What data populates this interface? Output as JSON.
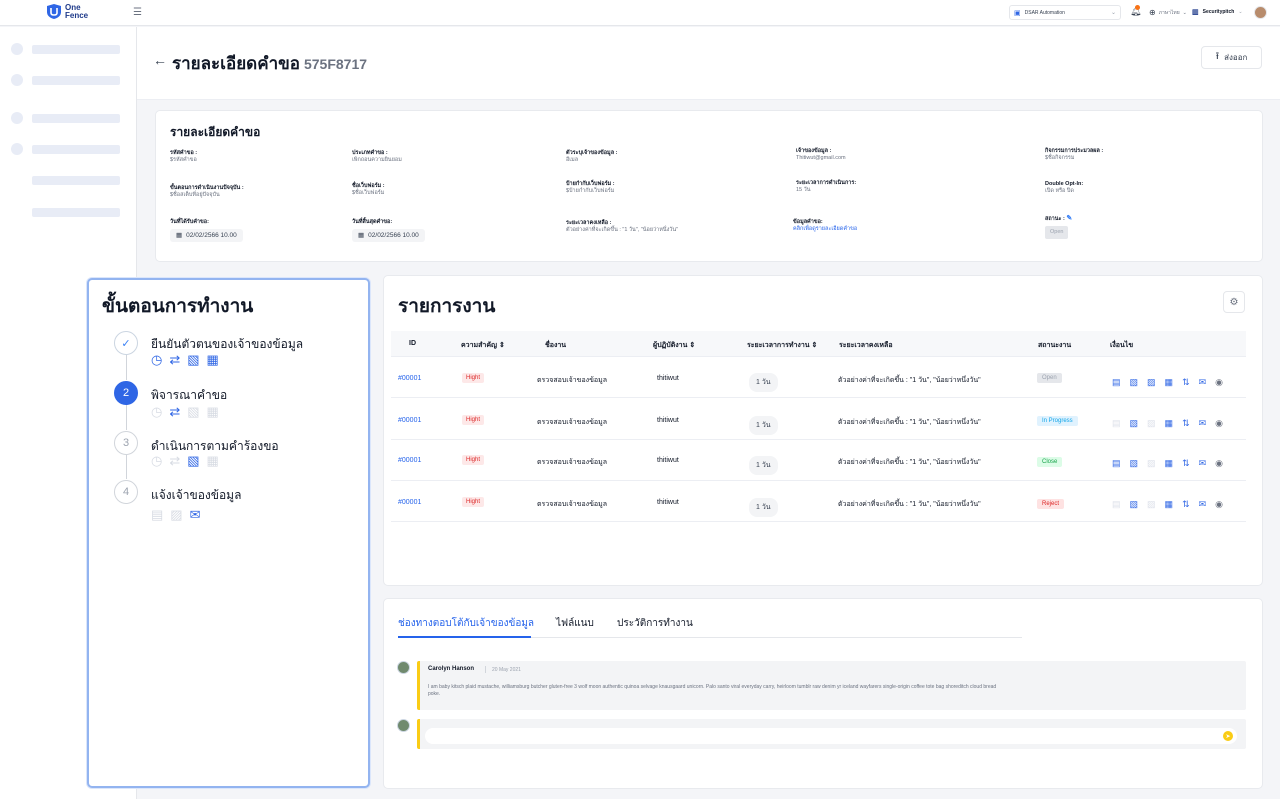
{
  "app": {
    "logo_line1": "One",
    "logo_line2": "Fence",
    "menu_icon": "menu-icon"
  },
  "topbar": {
    "workspace": "DSAR Automation",
    "language": "ภาษาไทย",
    "organization": "Securitypitch",
    "notification_icon": "bell-icon",
    "globe_icon": "globe-icon"
  },
  "page": {
    "title": "รายละเอียดคำขอ",
    "request_id": "575F8717",
    "export_label": "ส่งออก"
  },
  "request_details": {
    "title": "รายละเอียดคำขอ",
    "fields": [
      {
        "label": "รหัสคำขอ :",
        "value": "$รหัสคำขอ"
      },
      {
        "label": "ประเภทคำขอ :",
        "value": "เพิกถอนความยินยอม"
      },
      {
        "label": "ตัวระบุเจ้าของข้อมูล :",
        "value": "อีเมล"
      },
      {
        "label": "เจ้าของข้อมูล :",
        "value": "Thitiwut@gmail.com"
      },
      {
        "label": "กิจกรรมการประมวลผล :",
        "value": "$ชื่อกิจกรรม"
      },
      {
        "label": "ขั้นตอนการดำเนินงานปัจจุบัน :",
        "value": "$ชื่อสเต็บที่อยู่ปัจจุบัน"
      },
      {
        "label": "ชื่อเว็บฟอร์ม :",
        "value": "$ชื่อเว็บฟอร์ม"
      },
      {
        "label": "ป้ายกำกับเว็บฟอร์ม :",
        "value": "$ป้ายกำกับเว็บฟอร์ม"
      },
      {
        "label": "ระยะเวลาการดำเนินการ:",
        "value": "15 วัน"
      },
      {
        "label": "Double Opt-In:",
        "value": "เปิด หรือ ปิด"
      },
      {
        "label": "วันที่ได้รับคำขอ:",
        "value": "02/02/2566 10.00"
      },
      {
        "label": "วันที่สิ้นสุดคำขอ:",
        "value": "02/02/2566 10.00"
      },
      {
        "label": "ระยะเวลาคงเหลือ :",
        "value": "ตัวอย่างค่าที่จะเกิดขึ้น : \"1  วัน\", \"น้อยว่าหนึ่งวัน\""
      },
      {
        "label": "ข้อมูลคำขอ:",
        "value": "คลิกเพื่อดูรายละเอียดคำขอ"
      },
      {
        "label": "สถานะ :",
        "value": "Open"
      }
    ]
  },
  "workflow": {
    "title": "ขั้นตอนการทำงาน",
    "steps": [
      {
        "number": "✓",
        "label": "ยืนยันตัวตนของเจ้าของข้อมูล"
      },
      {
        "number": "2",
        "label": "พิจารณาคำขอ"
      },
      {
        "number": "3",
        "label": "ดำเนินการตามคำร้องขอ"
      },
      {
        "number": "4",
        "label": "แจ้งเจ้าของข้อมูล"
      }
    ]
  },
  "tasks": {
    "title": "รายการงาน",
    "columns": [
      "ID",
      "ความสำคัญ ⇕",
      "ชื่องาน",
      "ผู้ปฏิบัติงาน ⇕",
      "ระยะเวลาการทำงาน ⇕",
      "ระยะเวลาคงเหลือ",
      "สถานะงาน",
      "เงื่อนไข"
    ],
    "rows": [
      {
        "id": "#00001",
        "priority": "Hight",
        "name": "ตรวจสอบเจ้าของข้อมูล",
        "assignee": "thitiwut",
        "duration": "1 วัน",
        "remaining": "ตัวอย่างค่าที่จะเกิดขึ้น : \"1  วัน\", \"น้อยว่าหนึ่งวัน\"",
        "status": "Open"
      },
      {
        "id": "#00001",
        "priority": "Hight",
        "name": "ตรวจสอบเจ้าของข้อมูล",
        "assignee": "thitiwut",
        "duration": "1 วัน",
        "remaining": "ตัวอย่างค่าที่จะเกิดขึ้น : \"1  วัน\", \"น้อยว่าหนึ่งวัน\"",
        "status": "In Progress"
      },
      {
        "id": "#00001",
        "priority": "Hight",
        "name": "ตรวจสอบเจ้าของข้อมูล",
        "assignee": "thitiwut",
        "duration": "1 วัน",
        "remaining": "ตัวอย่างค่าที่จะเกิดขึ้น : \"1  วัน\", \"น้อยว่าหนึ่งวัน\"",
        "status": "Close"
      },
      {
        "id": "#00001",
        "priority": "Hight",
        "name": "ตรวจสอบเจ้าของข้อมูล",
        "assignee": "thitiwut",
        "duration": "1 วัน",
        "remaining": "ตัวอย่างค่าที่จะเกิดขึ้น : \"1  วัน\", \"น้อยว่าหนึ่งวัน\"",
        "status": "Reject"
      }
    ]
  },
  "bottom": {
    "tabs": [
      "ช่องทางตอบโต้กับเจ้าของข้อมูล",
      "ไฟล์แนบ",
      "ประวัติการทำงาน"
    ],
    "comment": {
      "author": "Carolyn Hanson",
      "date": "20 May 2021",
      "text": "I am baby kitsch plaid mustache, williamsburg butcher gluten-free 3 wolf moon authentic quinoa selvage knausgaard unicorn. Palo santo viral everyday carry, heirloom tumblr raw denim yr iceland wayfarers single-origin coffee tote bag shoreditch cloud bread poke."
    },
    "reply_placeholder": ""
  },
  "colors": {
    "primary": "#2f66e5",
    "accent_yellow": "#facc15",
    "danger": "#dc2626"
  }
}
